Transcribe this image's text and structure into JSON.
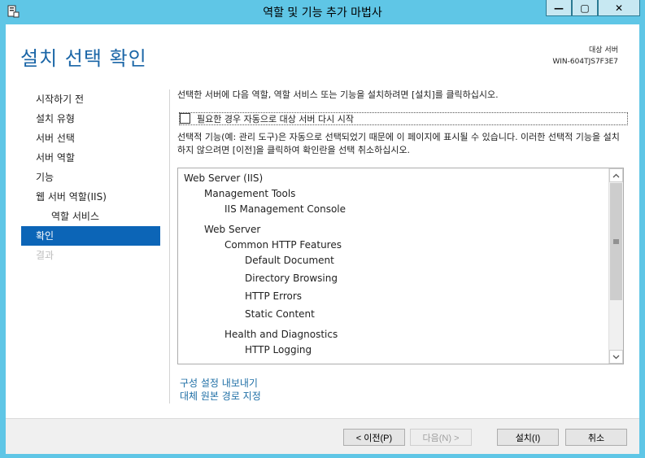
{
  "window": {
    "title": "역할 및 기능 추가 마법사",
    "minimize_label": "—",
    "maximize_label": "▢",
    "close_label": "✕"
  },
  "header": {
    "title": "설치 선택 확인",
    "dest_label": "대상 서버",
    "dest_server": "WIN-604TJS7F3E7"
  },
  "nav": {
    "items": [
      {
        "label": "시작하기 전",
        "state": "normal"
      },
      {
        "label": "설치 유형",
        "state": "normal"
      },
      {
        "label": "서버 선택",
        "state": "normal"
      },
      {
        "label": "서버 역할",
        "state": "normal"
      },
      {
        "label": "기능",
        "state": "normal"
      },
      {
        "label": "웹 서버 역할(IIS)",
        "state": "normal"
      },
      {
        "label": "역할 서비스",
        "state": "sub"
      },
      {
        "label": "확인",
        "state": "active"
      },
      {
        "label": "결과",
        "state": "disabled"
      }
    ]
  },
  "content": {
    "intro": "선택한 서버에 다음 역할, 역할 서비스 또는 기능을 설치하려면 [설치]를 클릭하십시오.",
    "restart_checkbox_label": "필요한 경우 자동으로 대상 서버 다시 시작",
    "restart_checked": false,
    "note": "선택적 기능(예: 관리 도구)은 자동으로 선택되었기 때문에 이 페이지에 표시될 수 있습니다. 이러한 선택적 기능을 설치하지 않으려면 [이전]을 클릭하여 확인란을 선택 취소하십시오.",
    "features": [
      {
        "label": "Web Server (IIS)",
        "level": 0
      },
      {
        "label": "Management Tools",
        "level": 1
      },
      {
        "label": "IIS Management Console",
        "level": 2
      },
      {
        "label": "Web Server",
        "level": 1
      },
      {
        "label": "Common HTTP Features",
        "level": 2
      },
      {
        "label": "Default Document",
        "level": 3
      },
      {
        "label": "Directory Browsing",
        "level": 3
      },
      {
        "label": "HTTP Errors",
        "level": 3
      },
      {
        "label": "Static Content",
        "level": 3
      },
      {
        "label": "Health and Diagnostics",
        "level": 2
      },
      {
        "label": "HTTP Logging",
        "level": 3
      }
    ],
    "export_link": "구성 설정 내보내기",
    "alt_source_link": "대체 원본 경로 지정"
  },
  "footer": {
    "prev_label": "< 이전(P)",
    "next_label": "다음(N) >",
    "install_label": "설치(I)",
    "cancel_label": "취소"
  },
  "colors": {
    "titlebar": "#5fc6e6",
    "accent": "#1b66a7",
    "nav_active": "#0c65b7"
  }
}
